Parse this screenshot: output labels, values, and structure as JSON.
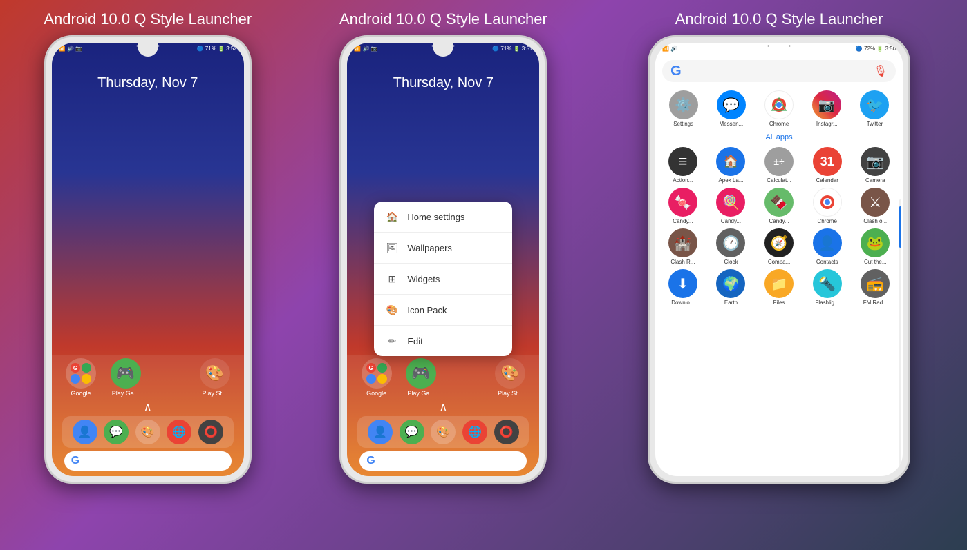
{
  "panels": [
    {
      "id": "panel1",
      "title": "Android 10.0 Q Style Launcher",
      "statusLeft": "📶 4G 🔊 📷",
      "statusRight": "🔵 71% 🔋 3:52",
      "date": "Thursday, Nov 7",
      "dockApps": [
        {
          "label": "Google",
          "color": "#e8f0fe",
          "icon": "G+",
          "iconColor": "#4285f4"
        },
        {
          "label": "Play Ga...",
          "color": "#4CAF50",
          "icon": "🎮",
          "iconColor": "white"
        },
        {
          "label": "",
          "color": "transparent",
          "icon": "",
          "iconColor": ""
        },
        {
          "label": "Play St...",
          "color": "#e8f0fe",
          "icon": "▶",
          "iconColor": "#4285f4"
        }
      ],
      "bottomApps": [
        {
          "color": "#4285f4",
          "icon": "👤"
        },
        {
          "color": "#4CAF50",
          "icon": "💬"
        },
        {
          "color": "transparent",
          "icon": "🎨"
        },
        {
          "color": "#ea4335",
          "icon": "🌐"
        },
        {
          "color": "#333",
          "icon": "⭕"
        }
      ]
    },
    {
      "id": "panel2",
      "title": "Android 10.0 Q Style Launcher",
      "statusLeft": "📶 4G 🔊 📷",
      "statusRight": "🔵 71% 🔋 3:51",
      "date": "Thursday, Nov 7",
      "menuItems": [
        {
          "icon": "🏠",
          "label": "Home settings"
        },
        {
          "icon": "🖼",
          "label": "Wallpapers"
        },
        {
          "icon": "⊞",
          "label": "Widgets"
        },
        {
          "icon": "🎨",
          "label": "Icon Pack"
        },
        {
          "icon": "✏",
          "label": "Edit"
        }
      ],
      "dockApps": [
        {
          "label": "Google",
          "color": "#e8f0fe",
          "icon": "G+",
          "iconColor": "#4285f4"
        },
        {
          "label": "Play Ga...",
          "color": "#4CAF50",
          "icon": "🎮",
          "iconColor": "white"
        },
        {
          "label": "",
          "color": "transparent",
          "icon": "",
          "iconColor": ""
        },
        {
          "label": "Play St...",
          "color": "#e8f0fe",
          "icon": "▶",
          "iconColor": "#4285f4"
        }
      ],
      "bottomApps": [
        {
          "color": "#4285f4",
          "icon": "👤"
        },
        {
          "color": "#4CAF50",
          "icon": "💬"
        },
        {
          "color": "transparent",
          "icon": "🎨"
        },
        {
          "color": "#ea4335",
          "icon": "🌐"
        },
        {
          "color": "#333",
          "icon": "⭕"
        }
      ]
    },
    {
      "id": "panel3",
      "title": "Android 10.0 Q Style Launcher",
      "statusLeft": "📶 4G 🔊",
      "statusRight": "🔵 72% 🔋 3:50",
      "topApps": [
        {
          "label": "Settings",
          "color": "#9e9e9e",
          "icon": "⚙️"
        },
        {
          "label": "Messen...",
          "color": "#0084ff",
          "icon": "💬"
        },
        {
          "label": "Chrome",
          "color": "#ea4335",
          "icon": "🌐"
        },
        {
          "label": "Instagr...",
          "color": "#e1306c",
          "icon": "📷"
        },
        {
          "label": "Twitter",
          "color": "#1da1f2",
          "icon": "🐦"
        }
      ],
      "allAppsLabel": "All apps",
      "gridApps": [
        {
          "label": "Action...",
          "color": "#333",
          "icon": "≡"
        },
        {
          "label": "Apex La...",
          "color": "#1a73e8",
          "icon": "🏠"
        },
        {
          "label": "Calculat...",
          "color": "#9e9e9e",
          "icon": "🔢"
        },
        {
          "label": "Calendar",
          "color": "#ea4335",
          "icon": "31"
        },
        {
          "label": "Camera",
          "color": "#424242",
          "icon": "📷"
        },
        {
          "label": "Candy...",
          "color": "#e91e63",
          "icon": "🍬"
        },
        {
          "label": "Candy...",
          "color": "#e91e63",
          "icon": "🍭"
        },
        {
          "label": "Candy...",
          "color": "#4CAF50",
          "icon": "🍫"
        },
        {
          "label": "Chrome",
          "color": "#ea4335",
          "icon": "🌐"
        },
        {
          "label": "Clash o...",
          "color": "#795548",
          "icon": "⚔"
        },
        {
          "label": "Clash R...",
          "color": "#795548",
          "icon": "🏰"
        },
        {
          "label": "Clock",
          "color": "#616161",
          "icon": "🕐"
        },
        {
          "label": "Compa...",
          "color": "#212121",
          "icon": "🧭"
        },
        {
          "label": "Contacts",
          "color": "#1a73e8",
          "icon": "👤"
        },
        {
          "label": "Cut the...",
          "color": "#4CAF50",
          "icon": "🐸"
        },
        {
          "label": "Downlo...",
          "color": "#1a73e8",
          "icon": "⬇"
        },
        {
          "label": "Earth",
          "color": "#1565c0",
          "icon": "🌍"
        },
        {
          "label": "Files",
          "color": "#f9a825",
          "icon": "📁"
        },
        {
          "label": "Flashlig...",
          "color": "#26c6da",
          "icon": "🔦"
        },
        {
          "label": "FM Rad...",
          "color": "#616161",
          "icon": "📻"
        }
      ]
    }
  ]
}
